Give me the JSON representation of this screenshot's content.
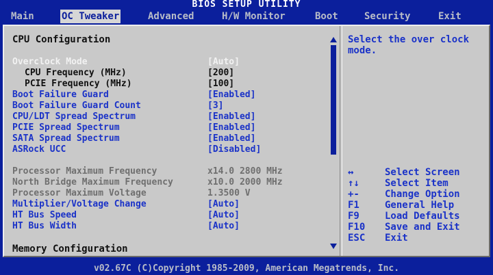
{
  "title": "BIOS SETUP UTILITY",
  "tabs": [
    "Main",
    "OC Tweaker",
    "Advanced",
    "H/W Monitor",
    "Boot",
    "Security",
    "Exit"
  ],
  "section": {
    "title": "CPU Configuration",
    "footer_title": "Memory Configuration"
  },
  "settings": [
    {
      "label": "Overclock Mode",
      "value": "[Auto]",
      "style": "white"
    },
    {
      "label": "  CPU Frequency (MHz)",
      "value": "[200]",
      "style": "dark"
    },
    {
      "label": "  PCIE Frequency (MHz)",
      "value": "[100]",
      "style": "dark"
    },
    {
      "label": "Boot Failure Guard",
      "value": "[Enabled]",
      "style": "blue"
    },
    {
      "label": "Boot Failure Guard Count",
      "value": "[3]",
      "style": "blue"
    },
    {
      "label": "CPU/LDT Spread Spectrum",
      "value": "[Enabled]",
      "style": "blue"
    },
    {
      "label": "PCIE Spread Spectrum",
      "value": "[Enabled]",
      "style": "blue"
    },
    {
      "label": "SATA Spread Spectrum",
      "value": "[Enabled]",
      "style": "blue"
    },
    {
      "label": "ASRock UCC",
      "value": "[Disabled]",
      "style": "blue"
    }
  ],
  "info": [
    {
      "label": "Processor Maximum Frequency",
      "value": "x14.0 2800 MHz",
      "style": "gray"
    },
    {
      "label": "North Bridge Maximum Frequency",
      "value": "x10.0 2000 MHz",
      "style": "gray"
    },
    {
      "label": "Processor Maximum Voltage",
      "value": "1.3500 V",
      "style": "gray"
    },
    {
      "label": "Multiplier/Voltage Change",
      "value": "[Auto]",
      "style": "blue"
    },
    {
      "label": "HT Bus Speed",
      "value": "[Auto]",
      "style": "blue"
    },
    {
      "label": "HT Bus Width",
      "value": "[Auto]",
      "style": "blue"
    }
  ],
  "help_text": "Select the over clock\nmode.",
  "key_legend": [
    {
      "key": "↔",
      "desc": "Select Screen"
    },
    {
      "key": "↑↓",
      "desc": "Select Item"
    },
    {
      "key": "+-",
      "desc": "Change Option"
    },
    {
      "key": "F1",
      "desc": "General Help"
    },
    {
      "key": "F9",
      "desc": "Load Defaults"
    },
    {
      "key": "F10",
      "desc": "Save and Exit"
    },
    {
      "key": "ESC",
      "desc": "Exit"
    }
  ],
  "footer": "v02.67C (C)Copyright 1985-2009, American Megatrends, Inc.",
  "colors": {
    "background": "#0b1f9c",
    "panel": "#c9c9c9",
    "highlight_text": "#1a32c8"
  }
}
